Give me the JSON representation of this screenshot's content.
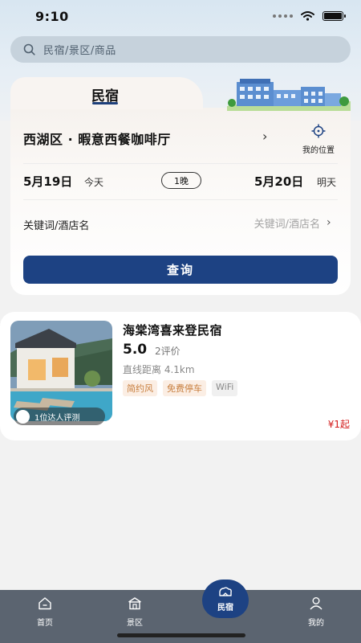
{
  "status_bar": {
    "time": "9:10"
  },
  "search": {
    "placeholder": "民宿/景区/商品"
  },
  "booking": {
    "tab_label": "民宿",
    "location": "西湖区 · 暇意西餐咖啡厅",
    "my_location_label": "我的位置",
    "checkin_date": "5月19日",
    "checkin_day": "今天",
    "nights": "1晚",
    "checkout_date": "5月20日",
    "checkout_day": "明天",
    "keyword_label": "关键词/酒店名",
    "keyword_placeholder": "关键词/酒店名",
    "search_button": "查询"
  },
  "listing": {
    "name": "海棠湾喜来登民宿",
    "rating": "5.0",
    "reviews": "2评价",
    "distance": "直线距离 4.1km",
    "tags": [
      "简约风",
      "免费停车",
      "WiFi"
    ],
    "review_chip": "1位达人评测",
    "price": "¥1起"
  },
  "tab_bar": {
    "home": "首页",
    "scenic": "景区",
    "homestay": "民宿",
    "mine": "我的"
  },
  "colors": {
    "primary": "#1d4283",
    "price": "#d31b1b",
    "tabbar": "#5b6470"
  }
}
